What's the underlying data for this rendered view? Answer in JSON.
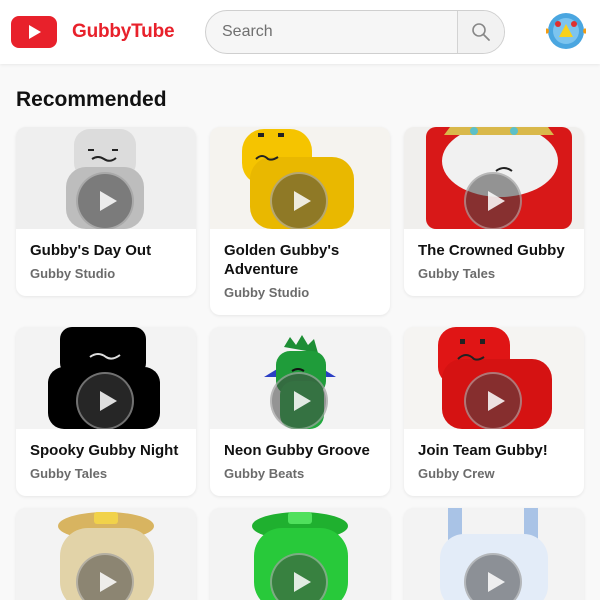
{
  "header": {
    "brand": "GubbyTube",
    "search_placeholder": "Search",
    "logo_icon": "youtube-play-logo-icon",
    "search_icon": "magnifier-icon",
    "brand_color": "#e8212b"
  },
  "section": {
    "title": "Recommended"
  },
  "videos": [
    {
      "title": "Gubby's Day Out",
      "channel": "Gubby Studio",
      "thumb_color": "#cfcfcf"
    },
    {
      "title": "Golden Gubby's Adventure",
      "channel": "Gubby Studio",
      "thumb_color": "#f2c400"
    },
    {
      "title": "The Crowned Gubby",
      "channel": "Gubby Tales",
      "thumb_color": "#d81818"
    },
    {
      "title": "Spooky Gubby Night",
      "channel": "Gubby Tales",
      "thumb_color": "#000000"
    },
    {
      "title": "Neon Gubby Groove",
      "channel": "Gubby Beats",
      "thumb_color": "#1f9c3a"
    },
    {
      "title": "Join Team Gubby!",
      "channel": "Gubby Crew",
      "thumb_color": "#e01515"
    },
    {
      "title": "",
      "channel": "",
      "thumb_color": "#e2d3a8"
    },
    {
      "title": "",
      "channel": "",
      "thumb_color": "#28c93a"
    },
    {
      "title": "",
      "channel": "",
      "thumb_color": "#a9c3e6"
    }
  ]
}
